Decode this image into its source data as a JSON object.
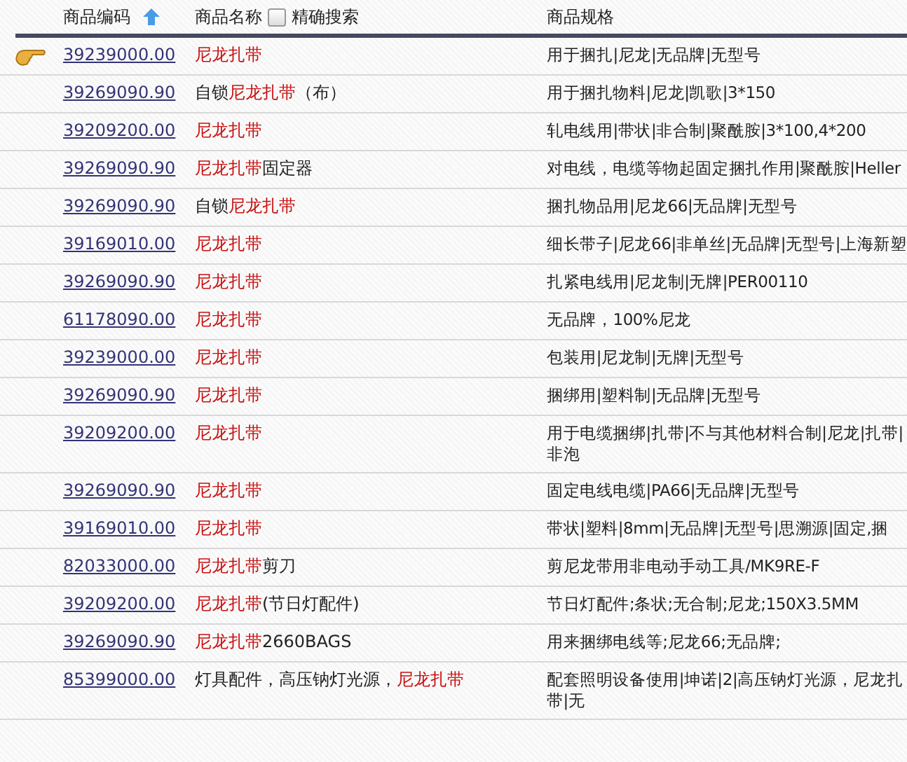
{
  "header": {
    "code_label": "商品编码",
    "name_label": "商品名称",
    "exact_search": {
      "label": "精确搜索",
      "checked": false
    },
    "spec_label": "商品规格"
  },
  "rows": [
    {
      "selected": true,
      "code": "39239000.00",
      "name": [
        {
          "text": "尼龙扎带",
          "highlight": true
        }
      ],
      "spec": "用于捆扎|尼龙|无品牌|无型号"
    },
    {
      "selected": false,
      "code": "39269090.90",
      "name": [
        {
          "text": "自锁",
          "highlight": false
        },
        {
          "text": "尼龙扎带",
          "highlight": true
        },
        {
          "text": "（布）",
          "highlight": false
        }
      ],
      "spec": "用于捆扎物料|尼龙|凯歌|3*150"
    },
    {
      "selected": false,
      "code": "39209200.00",
      "name": [
        {
          "text": "尼龙扎带",
          "highlight": true
        }
      ],
      "spec": "轧电线用|带状|非合制|聚酰胺|3*100,4*200"
    },
    {
      "selected": false,
      "code": "39269090.90",
      "name": [
        {
          "text": "尼龙扎带",
          "highlight": true
        },
        {
          "text": "固定器",
          "highlight": false
        }
      ],
      "spec": "对电线，电缆等物起固定捆扎作用|聚酰胺|Heller"
    },
    {
      "selected": false,
      "code": "39269090.90",
      "name": [
        {
          "text": "自锁",
          "highlight": false
        },
        {
          "text": "尼龙扎带",
          "highlight": true
        }
      ],
      "spec": "捆扎物品用|尼龙66|无品牌|无型号"
    },
    {
      "selected": false,
      "code": "39169010.00",
      "name": [
        {
          "text": "尼龙扎带",
          "highlight": true
        }
      ],
      "spec": "细长带子|尼龙66|非单丝|无品牌|无型号|上海新塑"
    },
    {
      "selected": false,
      "code": "39269090.90",
      "name": [
        {
          "text": "尼龙扎带",
          "highlight": true
        }
      ],
      "spec": "扎紧电线用|尼龙制|无牌|PER00110"
    },
    {
      "selected": false,
      "code": "61178090.00",
      "name": [
        {
          "text": "尼龙扎带",
          "highlight": true
        }
      ],
      "spec": "无品牌，100%尼龙"
    },
    {
      "selected": false,
      "code": "39239000.00",
      "name": [
        {
          "text": "尼龙扎带",
          "highlight": true
        }
      ],
      "spec": "包装用|尼龙制|无牌|无型号"
    },
    {
      "selected": false,
      "code": "39269090.90",
      "name": [
        {
          "text": "尼龙扎带",
          "highlight": true
        }
      ],
      "spec": "捆绑用|塑料制|无品牌|无型号"
    },
    {
      "selected": false,
      "code": "39209200.00",
      "name": [
        {
          "text": "尼龙扎带",
          "highlight": true
        }
      ],
      "spec": "用于电缆捆绑|扎带|不与其他材料合制|尼龙|扎带|非泡"
    },
    {
      "selected": false,
      "code": "39269090.90",
      "name": [
        {
          "text": "尼龙扎带",
          "highlight": true
        }
      ],
      "spec": "固定电线电缆|PA66|无品牌|无型号"
    },
    {
      "selected": false,
      "code": "39169010.00",
      "name": [
        {
          "text": "尼龙扎带",
          "highlight": true
        }
      ],
      "spec": "带状|塑料|8mm|无品牌|无型号|思溯源|固定,捆"
    },
    {
      "selected": false,
      "code": "82033000.00",
      "name": [
        {
          "text": "尼龙扎带",
          "highlight": true
        },
        {
          "text": "剪刀",
          "highlight": false
        }
      ],
      "spec": "剪尼龙带用非电动手动工具/MK9RE-F"
    },
    {
      "selected": false,
      "code": "39209200.00",
      "name": [
        {
          "text": "尼龙扎带",
          "highlight": true
        },
        {
          "text": "(节日灯配件)",
          "highlight": false
        }
      ],
      "spec": "节日灯配件;条状;无合制;尼龙;150X3.5MM"
    },
    {
      "selected": false,
      "code": "39269090.90",
      "name": [
        {
          "text": "尼龙扎带",
          "highlight": true
        },
        {
          "text": "2660BAGS",
          "highlight": false
        }
      ],
      "spec": "用来捆绑电线等;尼龙66;无品牌;"
    },
    {
      "selected": false,
      "code": "85399000.00",
      "name": [
        {
          "text": "灯具配件，高压钠灯光源，",
          "highlight": false
        },
        {
          "text": "尼龙扎带",
          "highlight": true
        }
      ],
      "spec": "配套照明设备使用|坤诺|2|高压钠灯光源，尼龙扎带|无"
    }
  ]
}
